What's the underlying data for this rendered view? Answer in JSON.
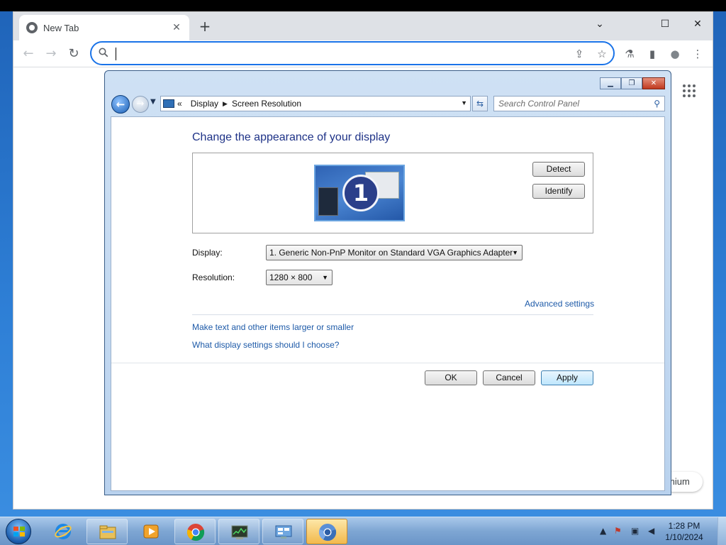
{
  "browser": {
    "tab_title": "New Tab",
    "tab_close": "✕",
    "new_tab": "+",
    "controls": {
      "minimize": "⌄",
      "maximize": "☐",
      "close": "✕"
    },
    "nav": {
      "back": "←",
      "forward": "→",
      "reload": "↻"
    },
    "omnibox": {
      "value": "",
      "placeholder": ""
    },
    "icons": {
      "share": "share-icon",
      "bookmark": "star-icon",
      "extension": "lab-icon",
      "side_panel": "side-panel-icon",
      "profile": "profile-icon",
      "menu": "kebab-icon"
    },
    "symbols": {
      "share": "⇪",
      "bookmark": "☆",
      "extension": "⚗",
      "side_panel": "▮",
      "profile": "●",
      "menu": "⋮"
    },
    "bottom_pill_text": "mium"
  },
  "control_panel": {
    "breadcrumb": {
      "root_chevron": "«",
      "items": [
        "Display",
        "Screen Resolution"
      ]
    },
    "search": {
      "placeholder": "Search Control Panel"
    },
    "caption": {
      "minimize": "▁",
      "restore": "❐",
      "close": "✕"
    },
    "heading": "Change the appearance of your display",
    "monitor_badge": "1",
    "buttons": {
      "detect": "Detect",
      "identify": "Identify",
      "ok": "OK",
      "cancel": "Cancel",
      "apply": "Apply"
    },
    "display": {
      "label": "Display:",
      "value": "1. Generic Non-PnP Monitor on Standard VGA Graphics Adapter"
    },
    "resolution": {
      "label": "Resolution:",
      "value": "1280 × 800"
    },
    "links": {
      "advanced": "Advanced settings",
      "text_size": "Make text and other items larger or smaller",
      "help": "What display settings should I choose?"
    }
  },
  "taskbar": {
    "items": [
      "internet-explorer-icon",
      "file-explorer-icon",
      "media-player-icon",
      "chrome-icon",
      "task-manager-icon",
      "control-panel-icon",
      "chromium-icon"
    ],
    "clock": {
      "time": "1:28 PM",
      "date": "1/10/2024"
    },
    "tray_symbols": {
      "expand": "▲",
      "flag": "⚑",
      "network": "▣",
      "volume": "◀"
    }
  },
  "colors": {
    "accent": "#1a73e8",
    "link": "#1d5aa8",
    "heading": "#1e3287",
    "active_taskbar": "#f2b94c"
  }
}
